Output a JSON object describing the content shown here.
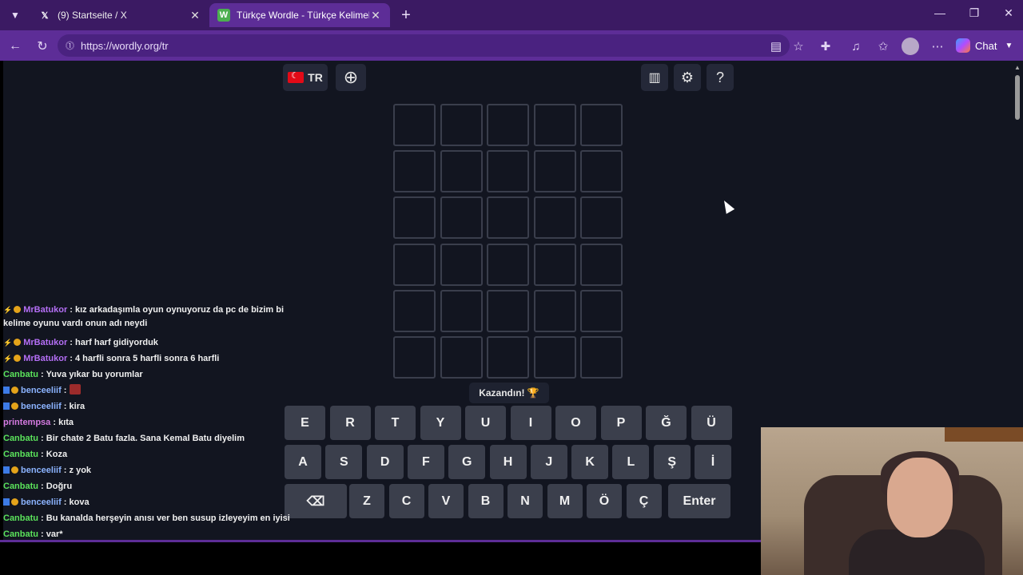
{
  "browser": {
    "tabs": [
      {
        "title": "(9) Startseite / X",
        "favicon": "X"
      },
      {
        "title": "Türkçe Wordle - Türkçe Kelimeleri",
        "favicon": "W"
      }
    ],
    "url": "https://wordly.org/tr",
    "chat_label": "Chat"
  },
  "game": {
    "language": "TR",
    "won_toast": "Kazandın! 🏆",
    "rows": 6,
    "cols": 5,
    "keyboard": {
      "row1": [
        "E",
        "R",
        "T",
        "Y",
        "U",
        "I",
        "O",
        "P",
        "Ğ",
        "Ü"
      ],
      "row2": [
        "A",
        "S",
        "D",
        "F",
        "G",
        "H",
        "J",
        "K",
        "L",
        "Ş",
        "İ"
      ],
      "row3": [
        "Z",
        "C",
        "V",
        "B",
        "N",
        "M",
        "Ö",
        "Ç"
      ],
      "enter": "Enter",
      "backspace": "⌫"
    }
  },
  "chat": {
    "messages": [
      {
        "user": "MrBatukor",
        "text": ": kız arkadaşımla oyun oynuyoruz da pc de bizim bi kelime oyunu vardı onun adı neydi",
        "color": "purple",
        "badges": "bolt"
      },
      {
        "user": "MrBatukor",
        "text": ": harf harf gidiyorduk",
        "color": "purple",
        "badges": "bolt"
      },
      {
        "user": "MrBatukor",
        "text": ": 4 harfli sonra 5 harfli sonra 6 harfli",
        "color": "purple",
        "badges": "bolt"
      },
      {
        "user": "Canbatu",
        "text": ": Yuva yıkar bu yorumlar",
        "color": "green",
        "badges": ""
      },
      {
        "user": "benceeliif",
        "text": ":",
        "color": "blue",
        "badges": "double"
      },
      {
        "user": "benceeliif",
        "text": ": kira",
        "color": "blue",
        "badges": "double"
      },
      {
        "user": "printempsa",
        "text": ": kıta",
        "color": "pink",
        "badges": ""
      },
      {
        "user": "Canbatu",
        "text": ": Bir chate 2 Batu fazla. Sana Kemal Batu diyelim",
        "color": "green",
        "badges": ""
      },
      {
        "user": "Canbatu",
        "text": ": Koza",
        "color": "green",
        "badges": ""
      },
      {
        "user": "benceeliif",
        "text": ": z yok",
        "color": "blue",
        "badges": "double"
      },
      {
        "user": "Canbatu",
        "text": ": Doğru",
        "color": "green",
        "badges": ""
      },
      {
        "user": "benceeliif",
        "text": ": kova",
        "color": "blue",
        "badges": "double"
      },
      {
        "user": "Canbatu",
        "text": ": Bu kanalda herşeyin anısı ver ben susup izleyeyim en iyisi",
        "color": "green",
        "badges": ""
      },
      {
        "user": "Canbatu",
        "text": ": var*",
        "color": "green",
        "badges": ""
      }
    ]
  }
}
